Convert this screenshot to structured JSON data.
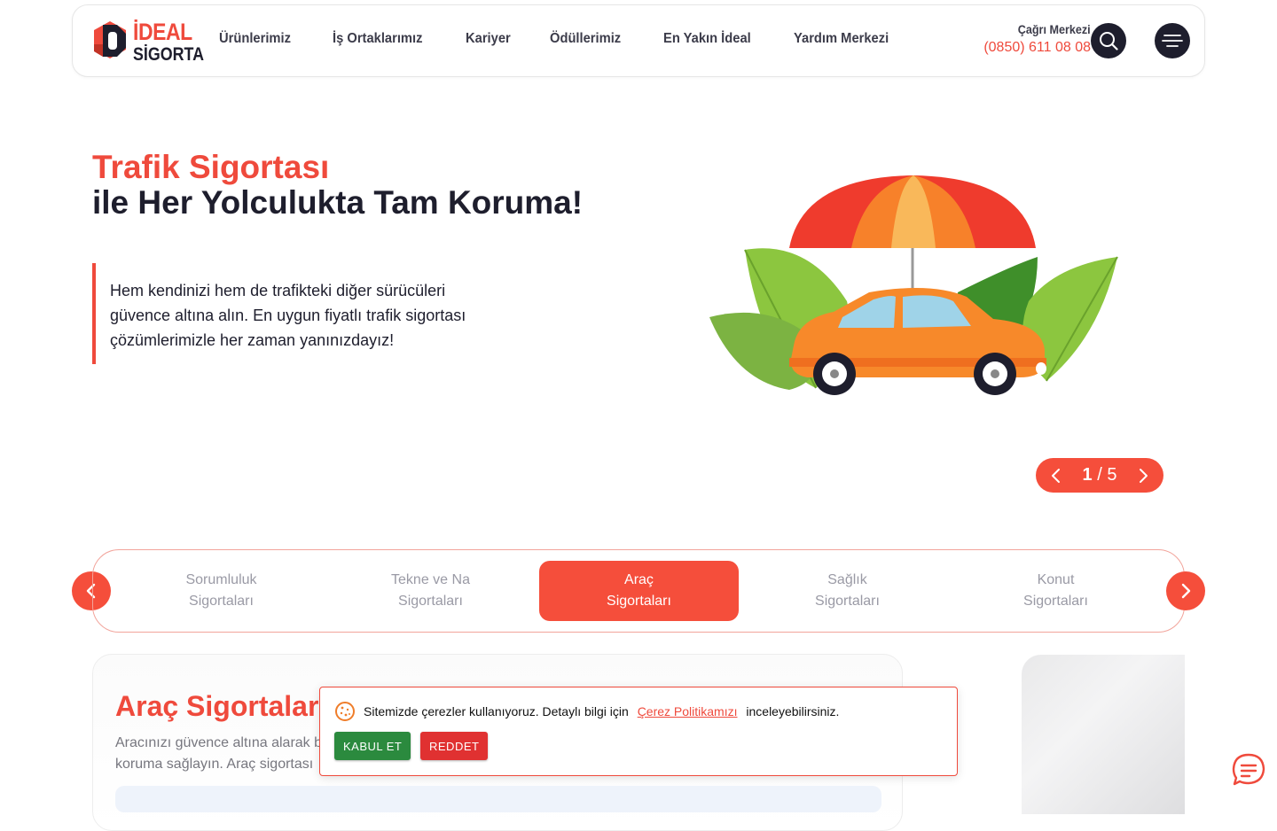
{
  "header": {
    "logo_line1": "İDEAL",
    "logo_line2": "SİGORTA",
    "nav": [
      "Ürünlerimiz",
      "İş Ortaklarımız",
      "Kariyer",
      "Ödüllerimiz",
      "En Yakın İdeal",
      "Yardım Merkezi"
    ],
    "call_center_label": "Çağrı Merkezi",
    "call_center_number": "(0850) 611 08 08",
    "icons": {
      "search": "search-icon",
      "menu": "hamburger-menu-icon"
    }
  },
  "hero": {
    "title_highlight": "Trafik Sigortası",
    "title_rest": "ile Her Yolculukta Tam Koruma!",
    "description": "Hem kendinizi hem de trafikteki diğer sürücüleri güvence altına alın. En uygun fiyatlı trafik sigortası çözümlerimizle her zaman yanınızdayız!",
    "slider": {
      "current": "1",
      "separator": "/",
      "total": "5"
    }
  },
  "categories": {
    "tabs": [
      {
        "line1": "Sorumluluk",
        "line2": "Sigortaları"
      },
      {
        "line1": "Tekne ve Na",
        "line2": "Sigortaları"
      },
      {
        "line1": "Araç",
        "line2": "Sigortaları"
      },
      {
        "line1": "Sağlık",
        "line2": "Sigortaları"
      },
      {
        "line1": "Konut",
        "line2": "Sigortaları"
      }
    ],
    "active_index": 2
  },
  "card": {
    "title": "Araç Sigortaları",
    "text_line1": "Aracınızı güvence altına alarak b",
    "text_line2": "koruma sağlayın. Araç sigortası"
  },
  "cookie": {
    "text_before": "Sitemizde çerezler kullanıyoruz. Detaylı bilgi için",
    "link": "Çerez Politikamızı",
    "text_after": "inceleyebilirsiniz.",
    "accept": "KABUL ET",
    "reject": "REDDET"
  },
  "colors": {
    "brand": "#ef4a3c",
    "dark": "#1e1e2d",
    "accept": "#2b8a3e",
    "reject": "#e03131"
  }
}
